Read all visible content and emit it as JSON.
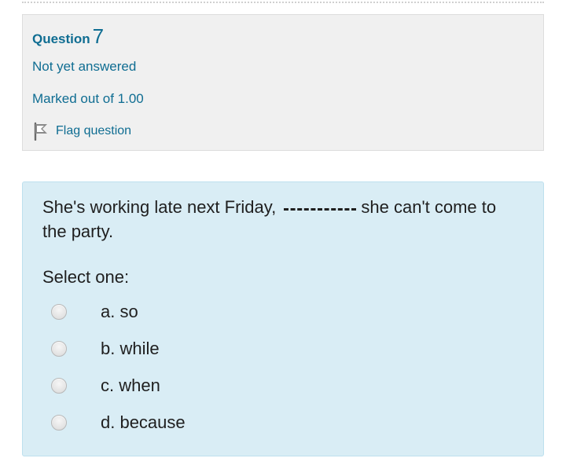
{
  "info": {
    "question_label": "Question",
    "question_number": "7",
    "status": "Not yet answered",
    "marked_out_of": "Marked out of 1.00",
    "flag_label": "Flag question"
  },
  "question": {
    "text_before_blank": "She's working late next Friday,",
    "text_after_blank": "she can't come to the party.",
    "prompt": "Select one:",
    "options": [
      {
        "label": "a. so"
      },
      {
        "label": "b. while"
      },
      {
        "label": "c. when"
      },
      {
        "label": "d. because"
      }
    ]
  },
  "colors": {
    "link": "#0f6d92",
    "info_background": "#f0f0f0",
    "formulation_background": "#d9edf5"
  }
}
